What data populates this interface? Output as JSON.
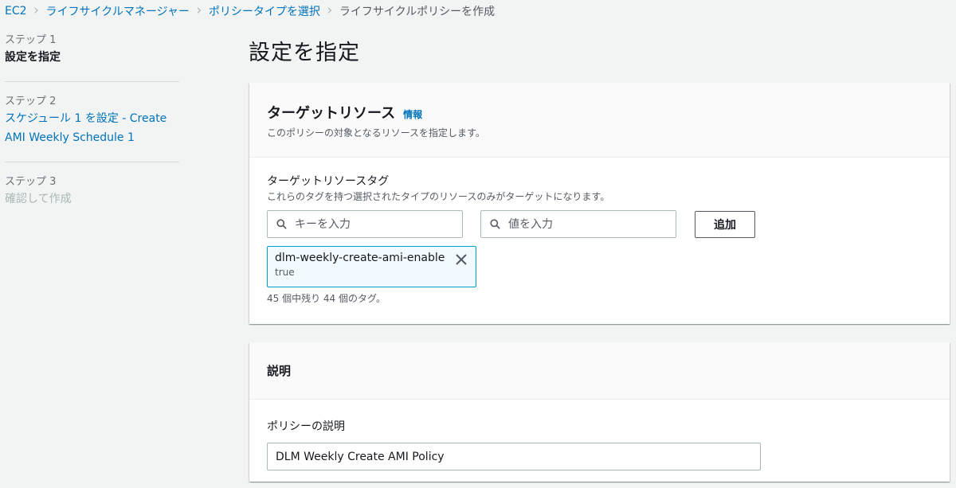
{
  "breadcrumb": {
    "items": [
      "EC2",
      "ライフサイクルマネージャー",
      "ポリシータイプを選択",
      "ライフサイクルポリシーを作成"
    ]
  },
  "steps": [
    {
      "number": "ステップ 1",
      "title": "設定を指定",
      "state": "active"
    },
    {
      "number": "ステップ 2",
      "title": "スケジュール 1 を設定 - Create AMI Weekly Schedule 1",
      "state": "link"
    },
    {
      "number": "ステップ 3",
      "title": "確認して作成",
      "state": "disabled"
    }
  ],
  "page_title": "設定を指定",
  "target_resources": {
    "heading": "ターゲットリソース",
    "info_link": "情報",
    "description": "このポリシーの対象となるリソースを指定します。",
    "tags_label": "ターゲットリソースタグ",
    "tags_description": "これらのタグを持つ選択されたタイプのリソースのみがターゲットになります。",
    "key_placeholder": "キーを入力",
    "value_placeholder": "値を入力",
    "add_button": "追加",
    "token": {
      "key": "dlm-weekly-create-ami-enable",
      "value": "true"
    },
    "tags_remaining": "45 個中残り 44 個のタグ。"
  },
  "description_panel": {
    "heading": "説明",
    "field_label": "ポリシーの説明",
    "field_value": "DLM Weekly Create AMI Policy"
  },
  "colors": {
    "link": "#0073bb",
    "token_border": "#00a1c9",
    "token_bg": "#f1faff",
    "page_bg": "#f2f3f3"
  },
  "icons": [
    "chevron-right-icon",
    "search-icon",
    "close-icon"
  ]
}
